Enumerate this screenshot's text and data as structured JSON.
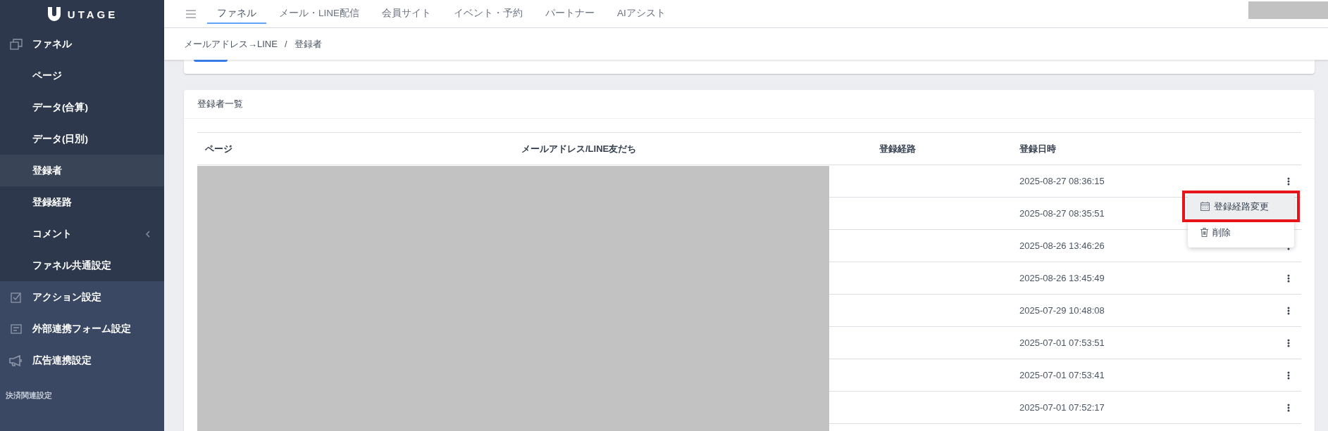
{
  "sidebar": {
    "logo": "UTAGE",
    "items": [
      {
        "kind": "group",
        "label": "ファネル",
        "children": [
          {
            "label": "ページ",
            "selected": false,
            "has_submenu": false
          },
          {
            "label": "データ(合算)",
            "selected": false,
            "has_submenu": false
          },
          {
            "label": "データ(日別)",
            "selected": false,
            "has_submenu": false
          },
          {
            "label": "登録者",
            "selected": true,
            "has_submenu": false
          },
          {
            "label": "登録経路",
            "selected": false,
            "has_submenu": false
          },
          {
            "label": "コメント",
            "selected": false,
            "has_submenu": true
          },
          {
            "label": "ファネル共通設定",
            "selected": false,
            "has_submenu": false
          }
        ]
      },
      {
        "kind": "item",
        "label": "アクション設定"
      },
      {
        "kind": "item",
        "label": "外部連携フォーム設定"
      },
      {
        "kind": "item",
        "label": "広告連携設定"
      },
      {
        "kind": "section",
        "label": "決済関連設定"
      }
    ]
  },
  "top_nav": {
    "tabs": [
      {
        "label": "ファネル",
        "selected": true
      },
      {
        "label": "メール・LINE配信",
        "selected": false
      },
      {
        "label": "会員サイト",
        "selected": false
      },
      {
        "label": "イベント・予約",
        "selected": false
      },
      {
        "label": "パートナー",
        "selected": false
      },
      {
        "label": "AIアシスト",
        "selected": false
      }
    ]
  },
  "breadcrumb": {
    "items": [
      "メールアドレス→LINE",
      "登録者"
    ],
    "separator": "/"
  },
  "table": {
    "title": "登録者一覧",
    "columns": [
      "ページ",
      "メールアドレス/LINE友だち",
      "登録経路",
      "登録日時"
    ],
    "rows": [
      {
        "date": "2025-08-27 08:36:15",
        "menu_button": true
      },
      {
        "date": "2025-08-27 08:35:51",
        "menu_button": false
      },
      {
        "date": "2025-08-26 13:46:26",
        "menu_button": true
      },
      {
        "date": "2025-08-26 13:45:49",
        "menu_button": true
      },
      {
        "date": "2025-07-29 10:48:08",
        "menu_button": true
      },
      {
        "date": "2025-07-01 07:53:51",
        "menu_button": true
      },
      {
        "date": "2025-07-01 07:53:41",
        "menu_button": true
      },
      {
        "date": "2025-07-01 07:52:17",
        "menu_button": true
      }
    ]
  },
  "context_menu": {
    "items": [
      {
        "label": "登録経路変更",
        "selected": true,
        "annotated": true
      },
      {
        "label": "削除",
        "selected": false,
        "annotated": false
      }
    ]
  }
}
